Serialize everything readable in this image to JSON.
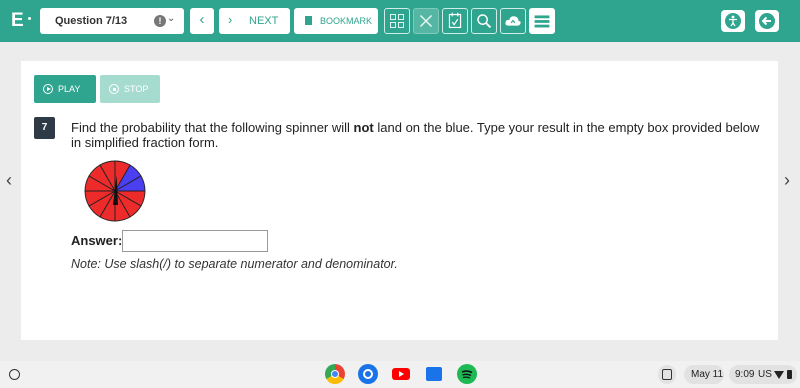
{
  "header": {
    "logo": "E",
    "question_select": "Question 7/13",
    "next_label": "NEXT",
    "bookmark_label": "BOOKMARK"
  },
  "controls": {
    "play_label": "PLAY",
    "stop_label": "STOP"
  },
  "question": {
    "number": "7",
    "text_before": "Find the probability that the following spinner will ",
    "text_bold": "not",
    "text_after": " land on the blue. Type your result in the empty box provided below in simplified fraction form.",
    "answer_label": "Answer:",
    "answer_value": "",
    "note": "Note: Use slash(/) to separate numerator and denominator."
  },
  "spinner": {
    "sectors": 12,
    "blue_sectors": 2,
    "colors": {
      "red": "#ee2b2b",
      "blue": "#4b3ff2",
      "outline": "#222222"
    }
  },
  "shelf": {
    "date": "May 11",
    "time": "9:09",
    "locale": "US",
    "apps": [
      "chrome-icon",
      "camera-icon",
      "youtube-icon",
      "files-icon",
      "spotify-icon"
    ]
  },
  "colors": {
    "accent": "#2fa58f",
    "accent_light": "#a6dccf",
    "qnum_bg": "#2e3b47"
  }
}
